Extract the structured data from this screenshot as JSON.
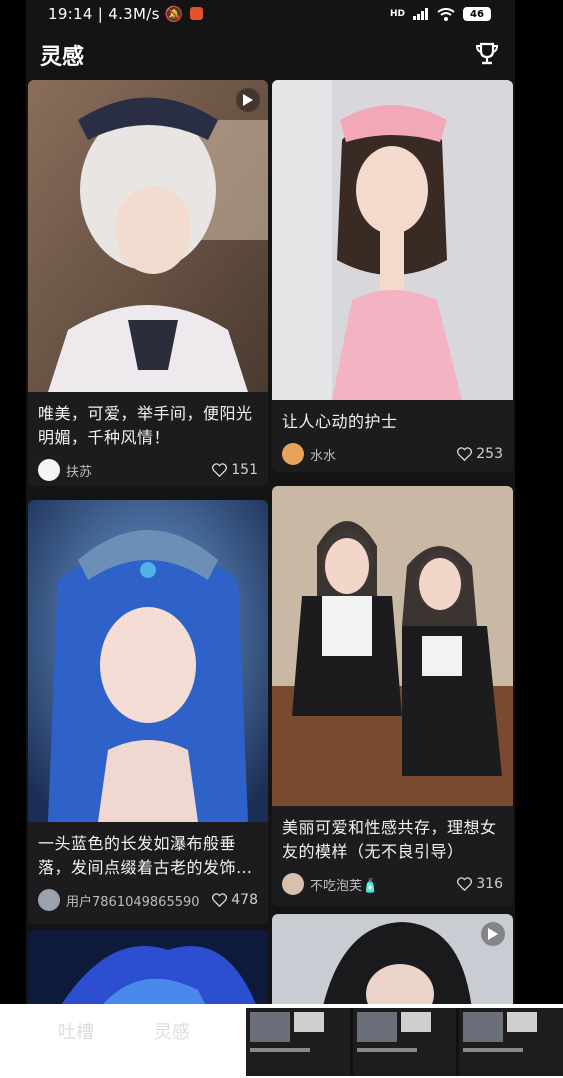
{
  "status": {
    "time": "19:14",
    "speed": "4.3M/s",
    "network": "HD",
    "battery": "46"
  },
  "header": {
    "title": "灵感",
    "trophy_icon": "trophy-icon"
  },
  "cards": [
    {
      "title": "唯美，可爱，举手间，便阳光明媚，千种风情！",
      "author": "扶苏",
      "likes": "151",
      "video": true
    },
    {
      "title": "让人心动的护士",
      "author": "水水",
      "likes": "253",
      "video": false
    },
    {
      "title": "一头蓝色的长发如瀑布般垂落，发间点缀着古老的发饰…",
      "author": "用户7861049865590",
      "likes": "478",
      "video": false
    },
    {
      "title": "美丽可爱和性感共存，理想女友的模样（无不良引导）",
      "author": "不吃泡芙🧴",
      "likes": "316",
      "video": false
    },
    {
      "title": "",
      "author": "",
      "likes": "",
      "video": false
    },
    {
      "title": "",
      "author": "",
      "likes": "",
      "video": true
    }
  ],
  "bottom_nav": {
    "tab1": "吐槽",
    "tab2": "灵感"
  }
}
